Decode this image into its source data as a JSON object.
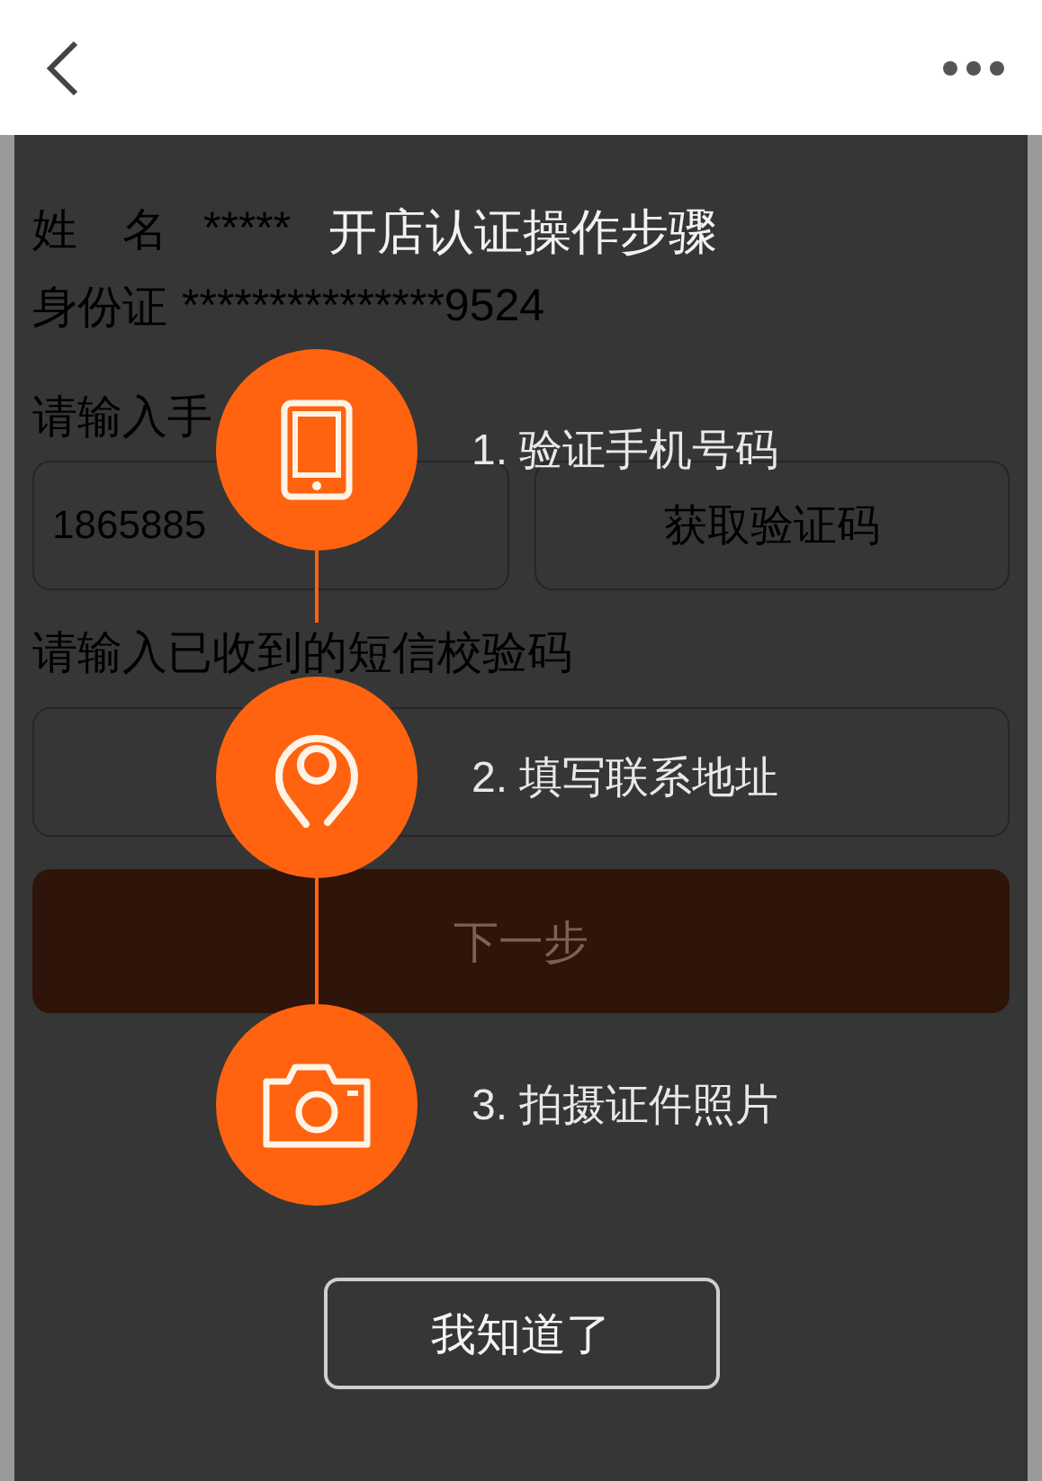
{
  "form": {
    "name_label": "姓　名",
    "name_value": "*****",
    "id_label": "身份证",
    "id_value": "***************9524",
    "phone_label": "请输入手",
    "phone_value": "1865885",
    "code_button": "获取验证码",
    "sms_label": "请输入已收到的短信校验码",
    "next_button": "下一步"
  },
  "guide": {
    "title": "开店认证操作步骤",
    "steps": [
      {
        "kind": "phone",
        "label": "1. 验证手机号码"
      },
      {
        "kind": "pin",
        "label": "2. 填写联系地址"
      },
      {
        "kind": "camera",
        "label": "3. 拍摄证件照片"
      }
    ],
    "button": "我知道了"
  }
}
